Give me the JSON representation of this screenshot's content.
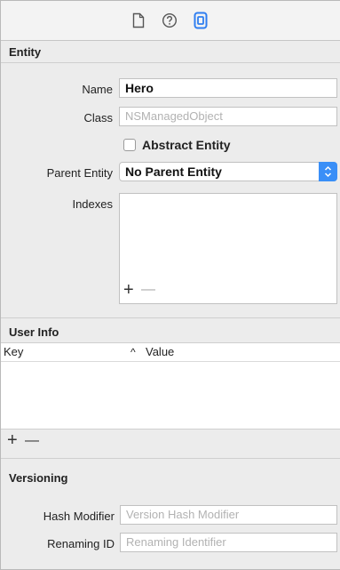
{
  "toolbar": {
    "icons": [
      "file-inspector-icon",
      "quick-help-icon",
      "data-model-inspector-icon"
    ]
  },
  "entity": {
    "header": "Entity",
    "name_label": "Name",
    "name_value": "Hero",
    "class_label": "Class",
    "class_placeholder": "NSManagedObject",
    "abstract_label": "Abstract Entity",
    "abstract_checked": false,
    "parent_label": "Parent Entity",
    "parent_value": "No Parent Entity",
    "indexes_label": "Indexes",
    "add_symbol": "+",
    "remove_symbol": "—"
  },
  "user_info": {
    "header": "User Info",
    "columns": {
      "key": "Key",
      "value_sort": "^",
      "value": "Value"
    },
    "rows": [],
    "add_symbol": "+",
    "remove_symbol": "—"
  },
  "versioning": {
    "header": "Versioning",
    "hash_label": "Hash Modifier",
    "hash_placeholder": "Version Hash Modifier",
    "renaming_label": "Renaming ID",
    "renaming_placeholder": "Renaming Identifier"
  },
  "colors": {
    "accent": "#3a8ff7",
    "panel_bg": "#ececec",
    "border": "#c1c1c1"
  }
}
